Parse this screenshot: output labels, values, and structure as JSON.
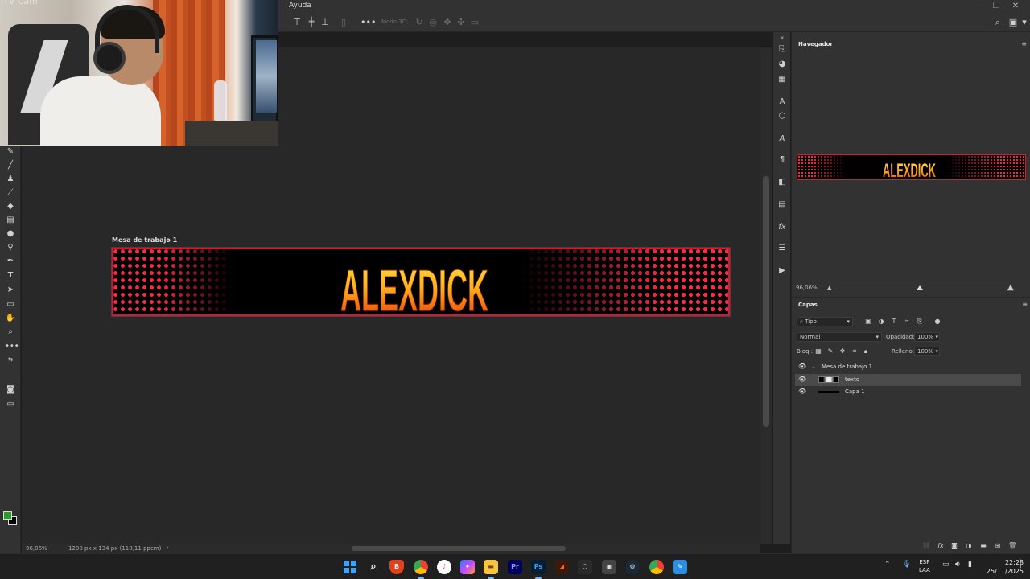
{
  "menubar": {
    "help_label": "Ayuda"
  },
  "options_bar": {
    "mode_3d_label": "Modo 3D:"
  },
  "webcam": {
    "label": "TV Cam"
  },
  "canvas": {
    "artboard_label": "Mesa de trabajo 1",
    "banner_text": "ALEXDICK"
  },
  "status_bar": {
    "zoom": "96,06%",
    "doc_info": "1200 px x 134 px (118,11 ppcm)",
    "arrow": "›"
  },
  "navigator": {
    "tab_label": "Navegador",
    "zoom": "96,06%"
  },
  "layers": {
    "tab_label": "Capas",
    "filter_label": "Tipo",
    "blend_mode": "Normal",
    "opacity_label": "Opacidad:",
    "opacity_value": "100%",
    "lock_label": "Bloq.:",
    "fill_label": "Relleno:",
    "fill_value": "100%",
    "items": [
      {
        "name": "Mesa de trabajo 1",
        "type": "artboard"
      },
      {
        "name": "texto",
        "type": "layer"
      },
      {
        "name": "Capa 1",
        "type": "layer"
      }
    ]
  },
  "taskbar": {
    "lang_line1": "ESP",
    "lang_line2": "LAA",
    "time": "22:28",
    "date": "25/11/2025",
    "apps": [
      "windows-start",
      "search",
      "brave",
      "chrome",
      "itunes",
      "copilot",
      "file-explorer",
      "premiere",
      "photoshop",
      "illustrator-like",
      "app-dark",
      "app-store",
      "steam",
      "chrome-profile",
      "app-blue"
    ]
  },
  "colors": {
    "accent_red": "#ff2a4a",
    "panel_bg": "#323232",
    "canvas_bg": "#282828",
    "foreground_swatch": "#2f9b2f",
    "background_swatch": "#000000"
  }
}
